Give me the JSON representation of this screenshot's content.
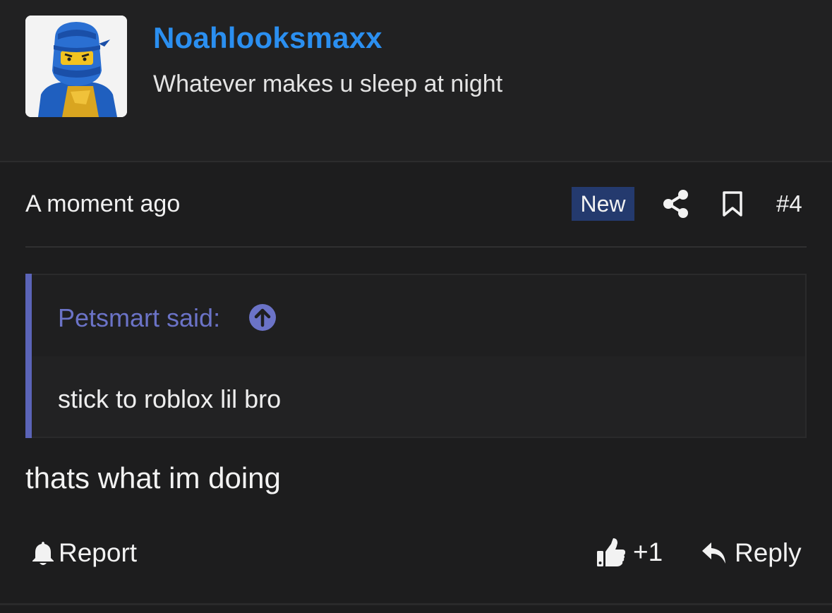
{
  "colors": {
    "background": "#1d1d1e",
    "header_background": "#212122",
    "username": "#2b8ff0",
    "quote_accent": "#5b64b8",
    "quote_author": "#6b73c7",
    "new_badge": "#243a6e"
  },
  "user": {
    "name": "Noahlooksmaxx",
    "title": "Whatever makes u sleep at night",
    "avatar_icon": "lego-ninja-avatar"
  },
  "attribution": {
    "time": "A moment ago",
    "badge": "New",
    "share_icon": "share-icon",
    "bookmark_icon": "bookmark-icon",
    "post_number": "#4"
  },
  "quote": {
    "author": "Petsmart said:",
    "jump_icon": "arrow-up-circle-icon",
    "text": "stick to roblox lil bro"
  },
  "message": {
    "body": "thats what im doing"
  },
  "actions": {
    "report_label": "Report",
    "like_label": "+1",
    "reply_label": "Reply"
  }
}
